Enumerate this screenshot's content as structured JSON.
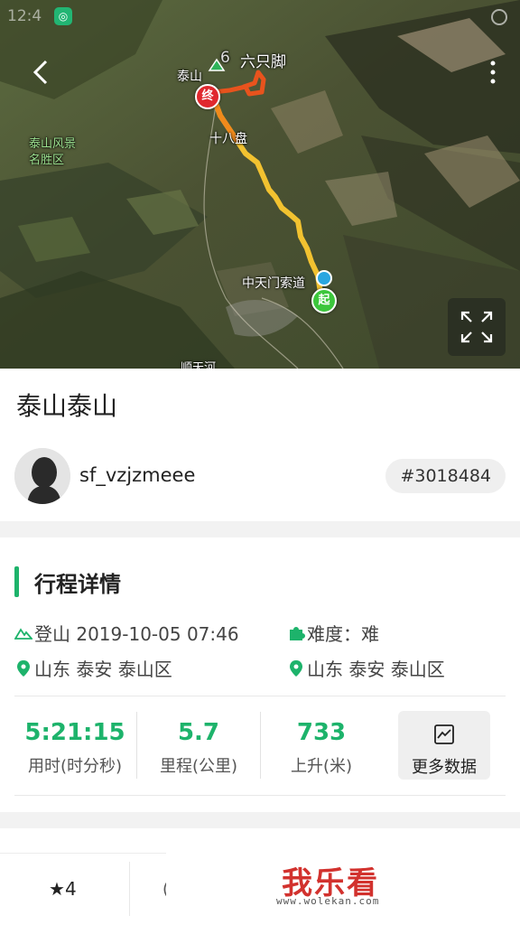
{
  "status_bar": {
    "time": "12:4"
  },
  "map": {
    "labels": {
      "taishan": "泰山",
      "liuzhijiao": "六只脚",
      "scenic_area": "泰山风景\n名胜区",
      "shibapan": "十八盘",
      "zhongtianmen": "中天门索道",
      "bottom_partial": "顺天河"
    },
    "end_pin": "终",
    "start_pin": "起",
    "route_colors": [
      "#f2c230",
      "#f08a1c",
      "#e8531d"
    ]
  },
  "trip": {
    "title": "泰山泰山",
    "username": "sf_vzjzmeee",
    "id": "#3018484"
  },
  "details": {
    "section_title": "行程详情",
    "activity": "登山 2019-10-05 07:46",
    "difficulty": "难度：难",
    "start_location": "山东 泰安 泰山区",
    "end_location": "山东 泰安 泰山区"
  },
  "stats": [
    {
      "value": "5:21:15",
      "label": "用时(时分秒)"
    },
    {
      "value": "5.7",
      "label": "里程(公里)"
    },
    {
      "value": "733",
      "label": "上升(米)"
    }
  ],
  "more_data_label": "更多数据",
  "bottom": {
    "favorites": "4",
    "watermark": "我乐看",
    "watermark_url": "www.wolekan.com"
  },
  "colors": {
    "accent": "#1db36b",
    "end_pin": "#e0282e",
    "start_pin": "#3cc63c"
  }
}
